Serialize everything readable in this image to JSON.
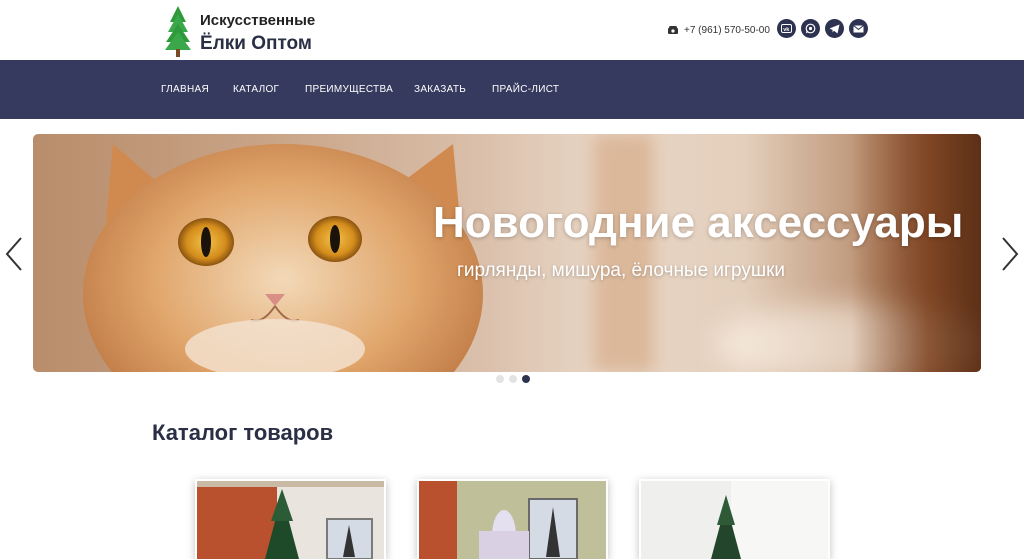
{
  "header": {
    "logo_line1": "Искусственные",
    "logo_line2": "Ёлки Оптом",
    "phone": "+7 (961) 570-50-00",
    "socials": [
      {
        "icon": "vk-icon"
      },
      {
        "icon": "whatsapp-icon"
      },
      {
        "icon": "telegram-icon"
      },
      {
        "icon": "email-icon"
      }
    ]
  },
  "nav": {
    "items": [
      "ГЛАВНАЯ",
      "КАТАЛОГ",
      "ПРЕИМУЩЕСТВА",
      "ЗАКАЗАТЬ",
      "ПРАЙС-ЛИСТ"
    ]
  },
  "slider": {
    "title": "Новогодние аксессуары",
    "subtitle": "гирлянды, мишура, ёлочные игрушки",
    "prev_icon": "chevron-left-icon",
    "next_icon": "chevron-right-icon",
    "slide_count": 3,
    "active_slide": 3
  },
  "catalog": {
    "title": "Каталог товаров",
    "cards": [
      {
        "image": "product-image-1"
      },
      {
        "image": "product-image-2"
      },
      {
        "image": "product-image-3"
      }
    ]
  },
  "colors": {
    "brand_dark": "#353a5e",
    "icon_bg": "#2d3250",
    "heading": "#2a2f45"
  }
}
